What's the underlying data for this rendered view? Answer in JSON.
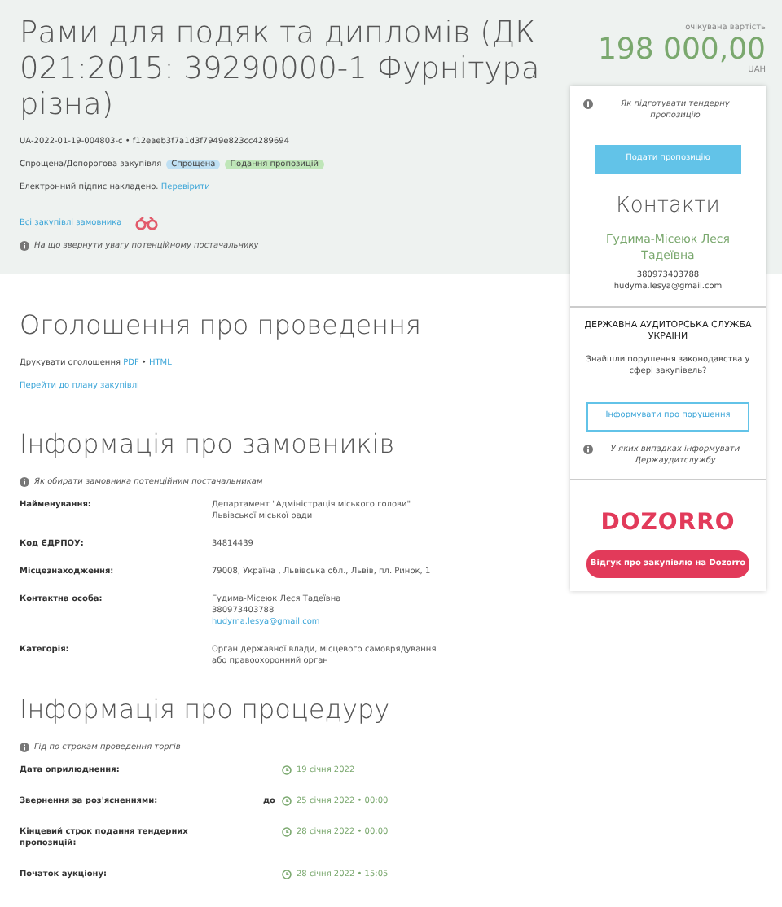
{
  "header": {
    "title": "Рами для подяк та дипломів (ДК 021:2015: 39290000-1 Фурнітура різна)",
    "tender_id": "UA-2022-01-19-004803-c • f12eaeb3f7a1d3f7949e823cc4289694",
    "procedure_type": "Спрощена/Допорогова закупівля",
    "tags": [
      {
        "label": "Спрощена",
        "color": "#bfe0f3"
      },
      {
        "label": "Подання пропозицій",
        "color": "#bfe6b8"
      }
    ],
    "signature_text": "Електронний підпис накладено.",
    "signature_link": "Перевірити",
    "all_purchases_link": "Всі закупівлі замовника",
    "hint": "На що звернути увагу потенційному постачальнику"
  },
  "price": {
    "label": "очікувана вартість",
    "amount": "198 000,00",
    "currency": "UAH"
  },
  "sidebar": {
    "hint": "Як підготувати тендерну пропозицію",
    "submit_button": "Подати пропозицію",
    "contacts_title": "Контакти",
    "contact_name": "Гудима-Місеюк Леся Тадеївна",
    "phone": "380973403788",
    "email": "hudyma.lesya@gmail.com",
    "audit_title": "ДЕРЖАВНА АУДИТОРСЬКА СЛУЖБА УКРАЇНИ",
    "audit_question": "Знайшли порушення законодавства у сфері закупівель?",
    "audit_button": "Інформувати про порушення",
    "audit_hint": "У яких випадках інформувати Держаудитслужбу",
    "dozorro_logo": "DOZORRO",
    "dozorro_button": "Відгук про закупівлю на Dozorro"
  },
  "announcement": {
    "title": "Оголошення про проведення",
    "print_label": "Друкувати оголошення",
    "formats": [
      "PDF",
      "HTML"
    ],
    "format_separator": "•",
    "plan_link": "Перейти до плану закупівлі"
  },
  "customer": {
    "title": "Інформація про замовників",
    "hint": "Як обирати замовника потенційним постачальникам",
    "rows": [
      {
        "label": "Найменування:",
        "lines": [
          {
            "text": "Департамент \"Адміністрація міського голови\" Львівської міської ради",
            "kind": "text"
          }
        ]
      },
      {
        "label": "Код ЄДРПОУ:",
        "lines": [
          {
            "text": "34814439",
            "kind": "text"
          }
        ]
      },
      {
        "label": "Місцезнаходження:",
        "lines": [
          {
            "text": "79008, Україна , Львівська обл., Львів, пл. Ринок, 1",
            "kind": "text"
          }
        ]
      },
      {
        "label": "Контактна особа:",
        "lines": [
          {
            "text": "Гудима-Місеюк Леся Тадеївна",
            "kind": "text"
          },
          {
            "text": "380973403788",
            "kind": "text"
          },
          {
            "text": "hudyma.lesya@gmail.com",
            "kind": "link"
          }
        ]
      },
      {
        "label": "Категорія:",
        "lines": [
          {
            "text": "Орган державної влади, місцевого самоврядування або правоохоронний орган",
            "kind": "text"
          }
        ]
      }
    ]
  },
  "procedure": {
    "title": "Інформація про процедуру",
    "hint": "Гід по строкам проведення торгів",
    "time_separator": "•",
    "rows": [
      {
        "label": "Дата оприлюднення:",
        "date": "19 січня 2022"
      },
      {
        "label": "Звернення за роз'ясненнями:",
        "prefix": "до",
        "date": "25 січня 2022",
        "time": "00:00"
      },
      {
        "label": "Кінцевий строк подання тендерних пропозицій:",
        "date": "28 січня 2022",
        "time": "00:00"
      },
      {
        "label": "Початок аукціону:",
        "date": "28 січня 2022",
        "time": "15:05"
      }
    ]
  }
}
